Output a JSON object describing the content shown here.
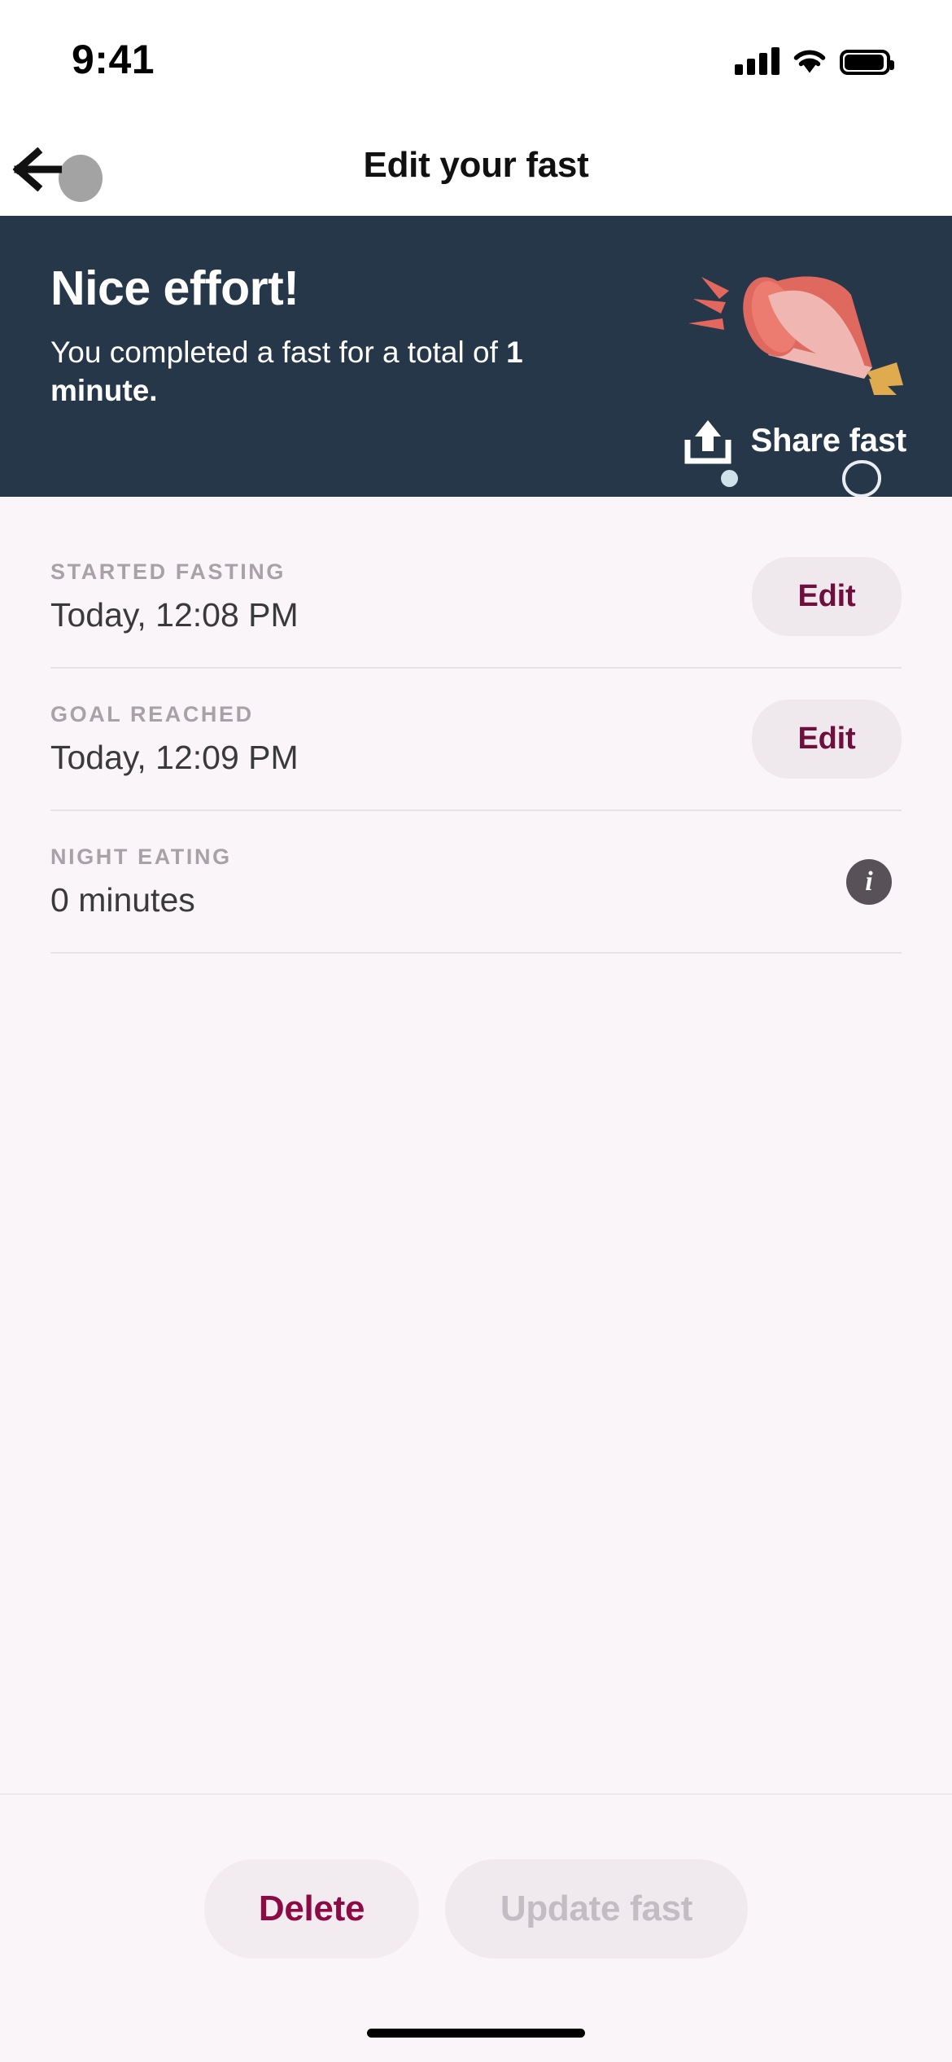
{
  "status_bar": {
    "time": "9:41",
    "cellular_icon": "signal-bars-icon",
    "wifi_icon": "wifi-icon",
    "battery_icon": "battery-full-icon"
  },
  "nav": {
    "back_icon": "back-arrow-icon",
    "title": "Edit your fast"
  },
  "hero": {
    "background_color": "#27374a",
    "title": "Nice effort!",
    "subtitle_prefix": "You completed a fast for a total of ",
    "subtitle_highlight": "1 minute",
    "subtitle_suffix": ".",
    "share_label": "Share fast",
    "share_icon": "share-upload-icon",
    "illustration": "party-popper-icon",
    "illustration_colors": {
      "cone_light": "#f0b7b2",
      "cone_rim": "#e0695f",
      "ribbon": "#e0ab4e",
      "burst": "#e2675c"
    },
    "confetti_dot_color": "#cfe2ea",
    "confetti_ring_color": "#e8eef2"
  },
  "details": {
    "rows": [
      {
        "label": "STARTED FASTING",
        "value": "Today, 12:08 PM",
        "action_type": "button",
        "action_label": "Edit"
      },
      {
        "label": "GOAL REACHED",
        "value": "Today, 12:09 PM",
        "action_type": "button",
        "action_label": "Edit"
      },
      {
        "label": "NIGHT EATING",
        "value": "0 minutes",
        "action_type": "info",
        "action_label": "i"
      }
    ]
  },
  "footer": {
    "delete_label": "Delete",
    "update_label": "Update fast",
    "delete_color": "#8c0b45",
    "update_color": "#c3bcc3"
  }
}
